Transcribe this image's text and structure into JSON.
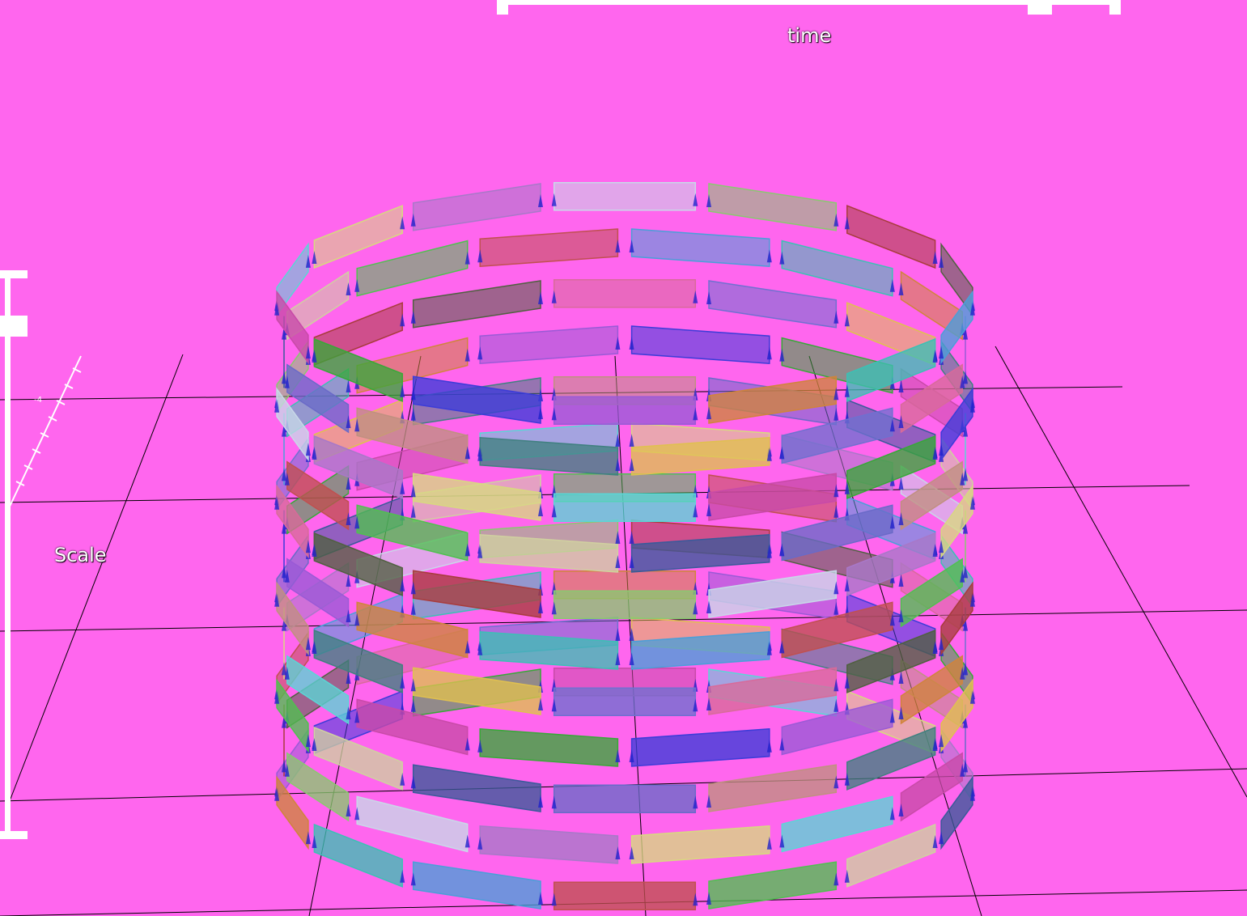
{
  "time_slider": {
    "label": "time",
    "value": 0.9
  },
  "scale_slider": {
    "label": "Scale",
    "value": 0.93
  },
  "scene": {
    "background": "#ff66ee",
    "widget_color": "#ffffff",
    "grid_color": "#000000",
    "arrow_color": "#2222cc",
    "axis_label": "-4"
  },
  "palette": [
    "#4a9fd8",
    "#3cc0b5",
    "#d0843c",
    "#9a5ad6",
    "#3c3cd8",
    "#38a838",
    "#c84aa8",
    "#5ad6d6",
    "#d8d880",
    "#a878c8",
    "#c8d8e8",
    "#8ac870",
    "#a83c3c",
    "#506040",
    "#d86a9a",
    "#7070d0",
    "#e0c050",
    "#408080",
    "#c09080",
    "#6a6ac8",
    "#3a5a9a",
    "#d0d0a0",
    "#50c050",
    "#c05050"
  ]
}
